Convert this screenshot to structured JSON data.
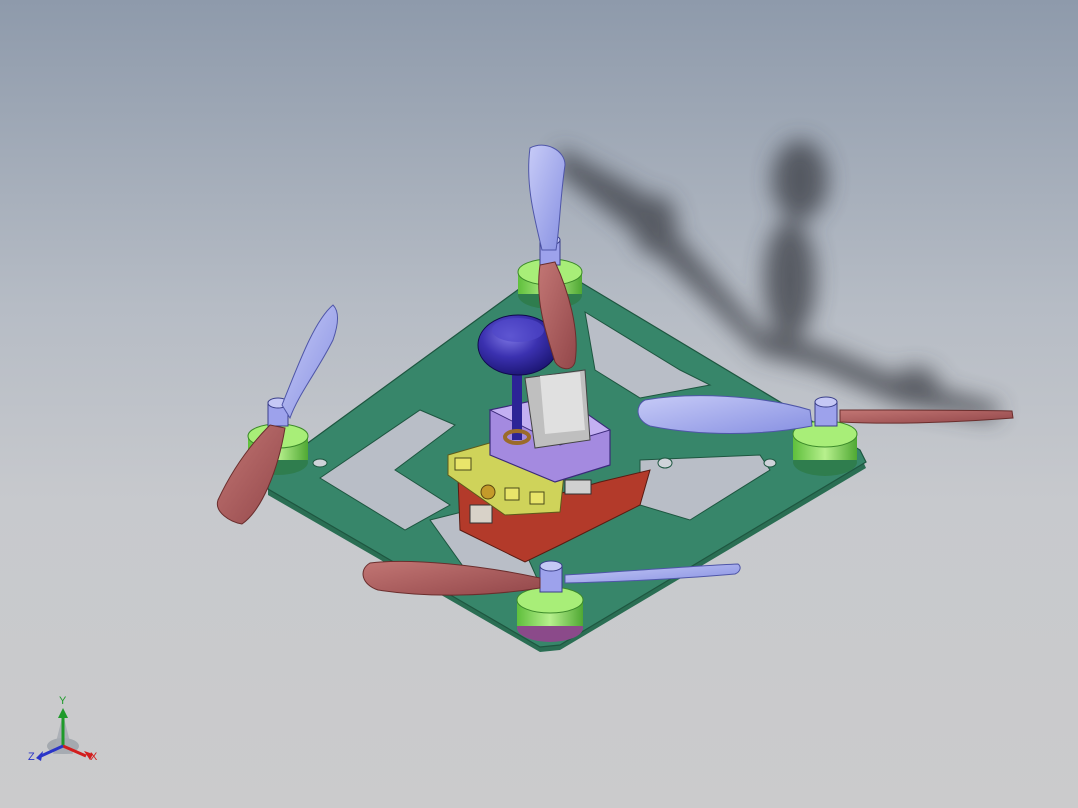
{
  "viewport": {
    "background_top": "#8e9aab",
    "background_bottom": "#cbcbcc"
  },
  "model": {
    "frame_color": "#2f7d5e",
    "motor_color": "#8ee05a",
    "blade_light_color": "#9aa0ee",
    "blade_dark_color": "#a85a58",
    "antenna_color": "#2c2496",
    "camera_mount_color": "#a890e8",
    "battery_color": "#b03a2a",
    "shadow_color": "#3a3c44"
  },
  "triad": {
    "x_label": "X",
    "y_label": "Y",
    "z_label": "Z",
    "x_color": "#d21e1e",
    "y_color": "#1f9a2a",
    "z_color": "#2a35c8"
  }
}
